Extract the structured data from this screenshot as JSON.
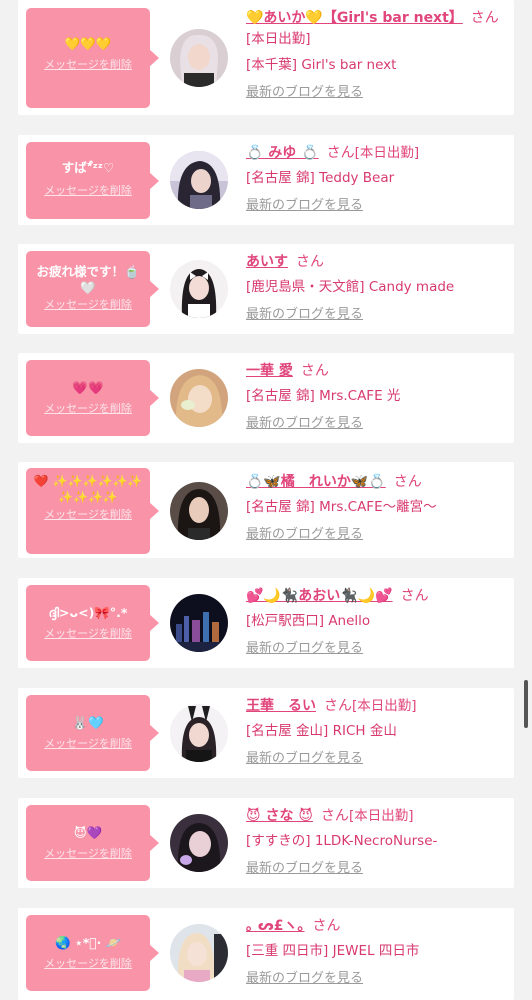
{
  "entries": [
    {
      "message": "💛💛💛",
      "delete_label": "メッセージを削除",
      "name": "💛あいか💛【Girl's bar next】",
      "honorific": "さん",
      "work_status": "",
      "shop_lines": [
        "[本日出勤]",
        "[本千葉] Girl's bar next"
      ],
      "blog_link": "最新のブログを見る",
      "avatar_icon": "avatar-photo-blonde-girl"
    },
    {
      "message": "すば*゚ᶻᶻ♡",
      "delete_label": "メッセージを削除",
      "name": "💍 みゆ 💍",
      "honorific": "さん",
      "work_status": "[本日出勤]",
      "shop_lines": [
        "[名古屋 錦] Teddy Bear"
      ],
      "blog_link": "最新のブログを見る",
      "avatar_icon": "avatar-photo-dark-hair"
    },
    {
      "message": "お疲れ様です！🍵🤍",
      "delete_label": "メッセージを削除",
      "name": "あいす",
      "honorific": "さん",
      "work_status": "",
      "shop_lines": [
        "[鹿児島県・天文館] Candy made"
      ],
      "blog_link": "最新のブログを見る",
      "avatar_icon": "avatar-photo-girl-bow"
    },
    {
      "message": "💗💗",
      "delete_label": "メッセージを削除",
      "name": "一華 愛",
      "honorific": "さん",
      "work_status": "",
      "shop_lines": [
        "[名古屋 錦] Mrs.CAFE 光"
      ],
      "blog_link": "最新のブログを見る",
      "avatar_icon": "avatar-photo-blonde-hand"
    },
    {
      "message": "❤️ ✨✨✨✨✨✨ ✨✨✨✨",
      "delete_label": "メッセージを削除",
      "name": "💍🦋橘　れいか🦋💍",
      "honorific": "さん",
      "work_status": "",
      "shop_lines": [
        "[名古屋 錦] Mrs.CAFE～離宮～"
      ],
      "blog_link": "最新のブログを見る",
      "avatar_icon": "avatar-photo-dark-long-hair"
    },
    {
      "message": "ദ്ദി>ᴗ<)🎀°.*",
      "delete_label": "メッセージを削除",
      "name": "💕🌙🐈‍⬛あおい🐈‍⬛🌙💕",
      "honorific": "さん",
      "work_status": "",
      "shop_lines": [
        "[松戸駅西口] Anello"
      ],
      "blog_link": "最新のブログを見る",
      "avatar_icon": "avatar-photo-night-city"
    },
    {
      "message": "🐰🩵",
      "delete_label": "メッセージを削除",
      "name": "王華　るい",
      "honorific": "さん",
      "work_status": "[本日出勤]",
      "shop_lines": [
        "[名古屋 金山] RICH 金山"
      ],
      "blog_link": "最新のブログを見る",
      "avatar_icon": "avatar-photo-bunny-girl"
    },
    {
      "message": "😈💜",
      "delete_label": "メッセージを削除",
      "name": "😈 さな 😈",
      "honorific": "さん",
      "work_status": "[本日出勤]",
      "shop_lines": [
        "[すすきの] 1LDK-NecroNurse-"
      ],
      "blog_link": "最新のブログを見る",
      "avatar_icon": "avatar-photo-purple-light"
    },
    {
      "message": "🌏 ⋆*ﾟ‧ 🪐",
      "delete_label": "メッセージを削除",
      "name": "｡ ᔕ£ヽ｡",
      "honorific": "さん",
      "work_status": "",
      "shop_lines": [
        "[三重 四日市] JEWEL 四日市"
      ],
      "blog_link": "最新のブログを見る",
      "avatar_icon": "avatar-photo-jewel-girl"
    }
  ],
  "colors": {
    "accent": "#e0457b",
    "bubble": "#f994a8",
    "link_gray": "#9a9a9a",
    "background": "#f2f2f2"
  }
}
